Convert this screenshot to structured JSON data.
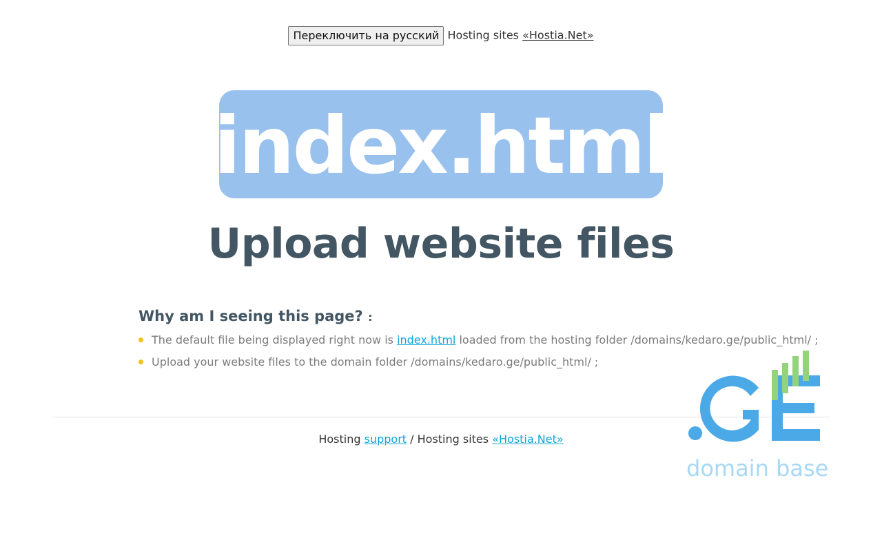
{
  "topbar": {
    "switch_button": "Переключить на русский",
    "hosting_sites_text": "Hosting sites",
    "hosting_link": "«Hostia.Net»"
  },
  "hero": {
    "filename": "index.html"
  },
  "subtitle": "Upload website files",
  "explanation": {
    "question": "Why am I seeing this page?",
    "colon": ":",
    "items": [
      {
        "before": "The default file being displayed right now is",
        "link": "index.html",
        "after": "loaded from the hosting folder /domains/kedaro.ge/public_html/ ;"
      },
      {
        "text": "Upload your website files to the domain folder /domains/kedaro.ge/public_html/ ;"
      }
    ]
  },
  "footer": {
    "hosting_text": "Hosting",
    "support_link": "support",
    "separator_text": "/ Hosting sites",
    "hosting_link": "«Hostia.Net»"
  },
  "logo": {
    "mark": ".GE",
    "tagline": "domain base",
    "colors": {
      "blue": "#4aa9e6",
      "green": "#93d37c",
      "tagline": "#a7d8f4"
    }
  },
  "colors": {
    "hero_bg": "#98c1ee",
    "heading": "#435663",
    "link": "#0ea5d8",
    "bullet": "#f4c21a",
    "body_text": "#7b7b7b"
  }
}
